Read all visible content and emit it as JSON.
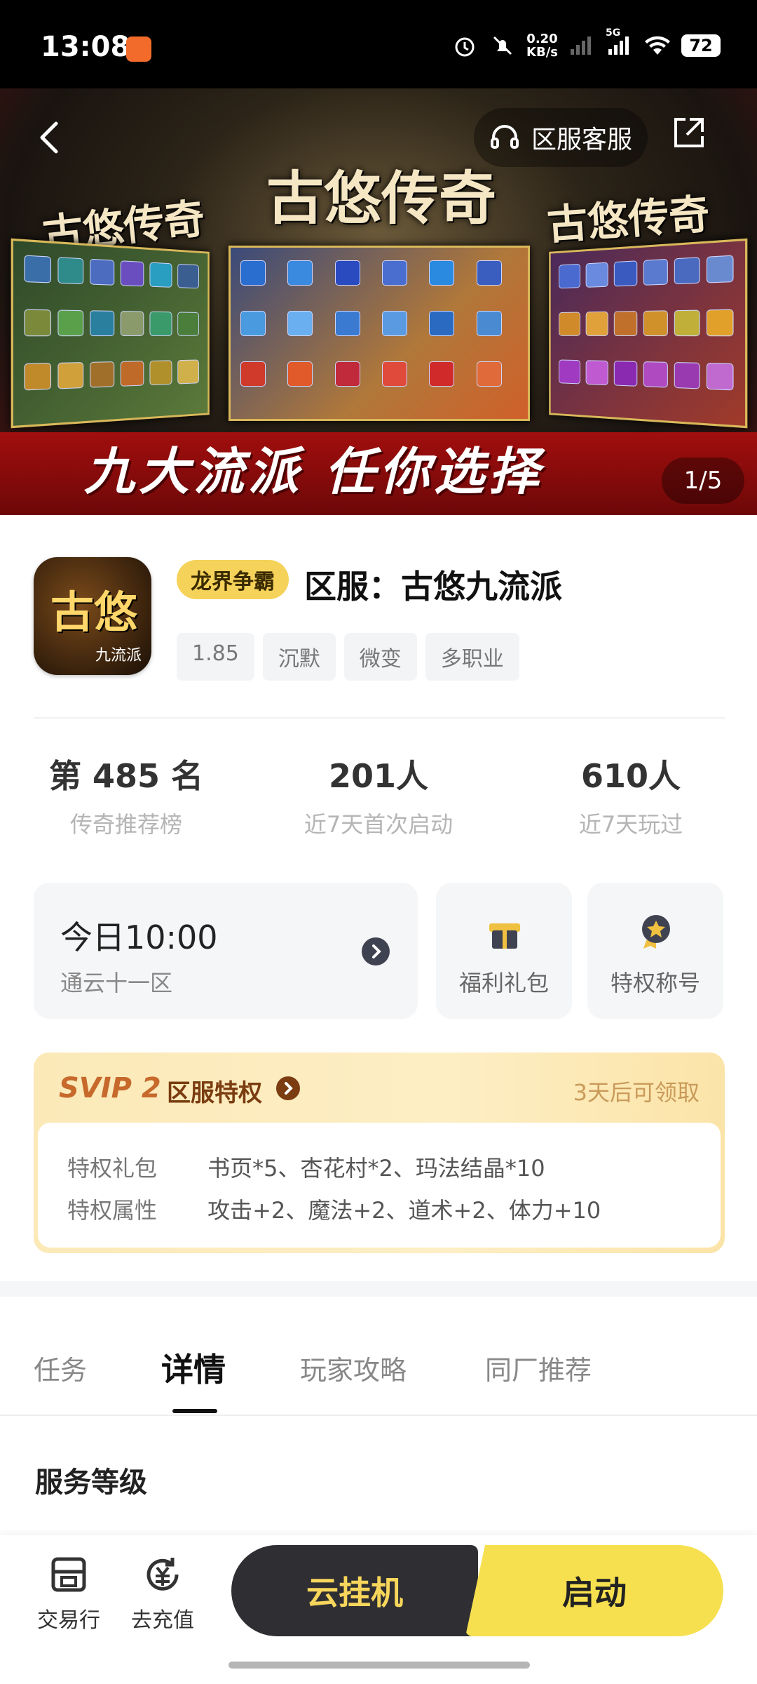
{
  "status_bar": {
    "time": "13:08",
    "net_speed_value": "0.20",
    "net_speed_unit": "KB/s",
    "network": "5G",
    "battery": "72"
  },
  "banner": {
    "logo_text": "古悠传奇",
    "slogan": "九大流派 任你选择",
    "page_indicator": "1/5",
    "service_label": "区服客服"
  },
  "game": {
    "icon_text": "古悠",
    "icon_sub": "九流派",
    "tag": "龙界争霸",
    "title": "区服：古悠九流派",
    "tags": [
      "1.85",
      "沉默",
      "微变",
      "多职业"
    ]
  },
  "stats": [
    {
      "value": "第 485 名",
      "label": "传奇推荐榜"
    },
    {
      "value": "201人",
      "label": "近7天首次启动"
    },
    {
      "value": "610人",
      "label": "近7天玩过"
    }
  ],
  "server": {
    "time": "今日10:00",
    "name": "通云十一区"
  },
  "quick": {
    "gift": "福利礼包",
    "title_badge": "特权称号"
  },
  "svip": {
    "brand": "SVIP 2",
    "title": "区服特权",
    "claim": "3天后可领取",
    "rows": [
      {
        "key": "特权礼包",
        "value": "书页*5、杏花村*2、玛法结晶*10"
      },
      {
        "key": "特权属性",
        "value": "攻击+2、魔法+2、道术+2、体力+10"
      }
    ]
  },
  "tabs": [
    "任务",
    "详情",
    "玩家攻略",
    "同厂推荐"
  ],
  "active_tab": "详情",
  "section_title": "服务等级",
  "bottom": {
    "trade": "交易行",
    "recharge": "去充值",
    "cloud": "云挂机",
    "start": "启动"
  },
  "colors": {
    "accent_yellow": "#f7e04f",
    "dark_button": "#2f2f33",
    "svip_brown": "#7a3c10"
  }
}
